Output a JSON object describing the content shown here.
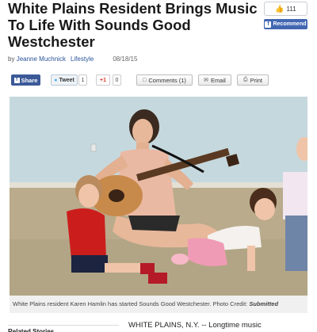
{
  "article": {
    "headline": "White Plains Resident Brings Music To Life With Sounds Good Westchester",
    "byline_prefix": "by",
    "author": "Jeanne Muchnick",
    "section": "Lifestyle",
    "date": "08/18/15",
    "caption_text": "White Plains resident Karen Hamlin has started Sounds Good Westchester. Photo Credit:",
    "caption_credit": "Submitted",
    "lede": "WHITE PLAINS, N.Y. -- Longtime music",
    "related_label": "Related Stories"
  },
  "facebook": {
    "like_count": "111",
    "recommend_label": "Recommend"
  },
  "share": {
    "fb_share_label": "Share",
    "tweet_label": "Tweet",
    "tweet_count": "1",
    "gplus_label": "+1",
    "gplus_count": "0",
    "comments_label": "Comments (1)",
    "email_label": "Email",
    "print_label": "Print"
  },
  "icons": [
    "thumbs-up-icon",
    "facebook-f-icon",
    "twitter-bird-icon",
    "google-plus-icon",
    "comment-bubble-icon",
    "envelope-icon",
    "printer-icon"
  ],
  "colors": {
    "facebook_blue": "#3b5998",
    "recommend_blue": "#4267b2",
    "link_blue": "#2a5599",
    "twitter_blue": "#55acee",
    "gplus_red": "#d73d32"
  }
}
